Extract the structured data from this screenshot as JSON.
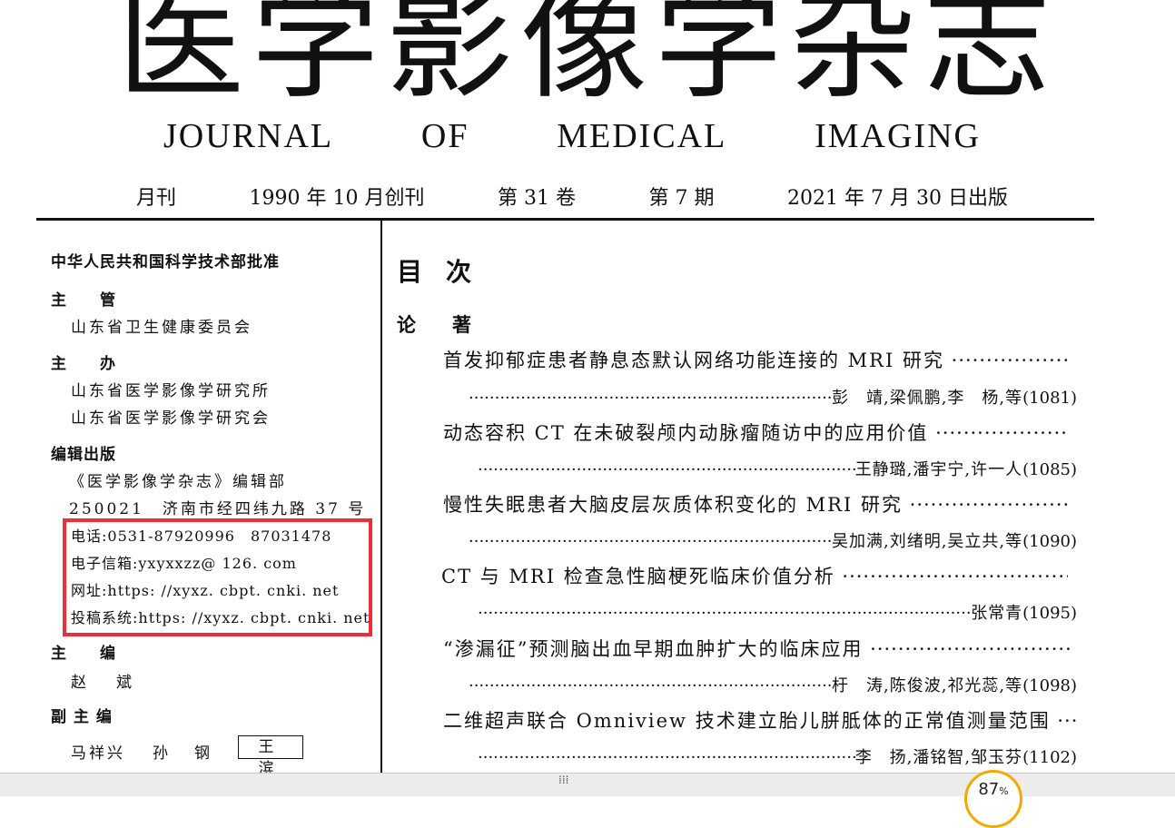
{
  "masthead": {
    "title": "医学影像学杂志",
    "subtitle_words": [
      "JOURNAL",
      "OF",
      "MEDICAL",
      "IMAGING"
    ]
  },
  "publication": {
    "frequency": "月刊",
    "founded": "1990 年 10 月创刊",
    "volume": "第 31 卷",
    "issue": "第 7 期",
    "published": "2021 年 7 月 30 日出版"
  },
  "info": {
    "approval": "中华人民共和国科学技术部批准",
    "supervisor_label": "主　　管",
    "supervisor": "山东省卫生健康委员会",
    "sponsor_label": "主　　办",
    "sponsors": [
      "山东省医学影像学研究所",
      "山东省医学影像学研究会"
    ],
    "editorial_label": "编辑出版",
    "editorial_dept": "《医学影像学杂志》编辑部",
    "address": "250021　济南市经四纬九路 37 号",
    "phone": "电话:0531-87920996　87031478",
    "email": "电子信箱:yxyxxzz@ 126. com",
    "website": "网址:https: //xyxz. cbpt. cnki. net",
    "submission": "投稿系统:https: //xyxz. cbpt. cnki. net",
    "editor_label": "主　　编",
    "editor": "赵　斌",
    "deputy_label": "副 主 编",
    "deputies": [
      "马祥兴",
      "孙　钢",
      "王　滨"
    ]
  },
  "toc": {
    "title": "目次",
    "section": "论著",
    "articles": [
      {
        "title": "首发抑郁症患者静息态默认网络功能连接的 MRI 研究",
        "authors": "彭　靖,梁佩鹏,李　杨,等",
        "page": "(1081)"
      },
      {
        "title": "动态容积 CT 在未破裂颅内动脉瘤随访中的应用价值",
        "authors": "王静璐,潘宇宁,许一人",
        "page": "(1085)"
      },
      {
        "title": "慢性失眠患者大脑皮层灰质体积变化的 MRI 研究",
        "authors": "吴加满,刘绪明,吴立共,等",
        "page": "(1090)"
      },
      {
        "title": "CT 与 MRI 检查急性脑梗死临床价值分析",
        "authors": "张常青",
        "page": "(1095)"
      },
      {
        "title": "“渗漏征”预测脑出血早期血肿扩大的临床应用",
        "authors": "杅　涛,陈俊波,祁光蕊,等",
        "page": "(1098)"
      },
      {
        "title": "二维超声联合 Omniview 技术建立胎儿胼胝体的正常值测量范围",
        "authors": "李　扬,潘铭智,邹玉芬",
        "page": "(1102)"
      }
    ]
  },
  "viewer": {
    "zoom_value": "87",
    "zoom_unit": "%",
    "grip": "⁞⁞⁞",
    "highlight_color": "#e8303a",
    "badge_color": "#f2a900"
  }
}
